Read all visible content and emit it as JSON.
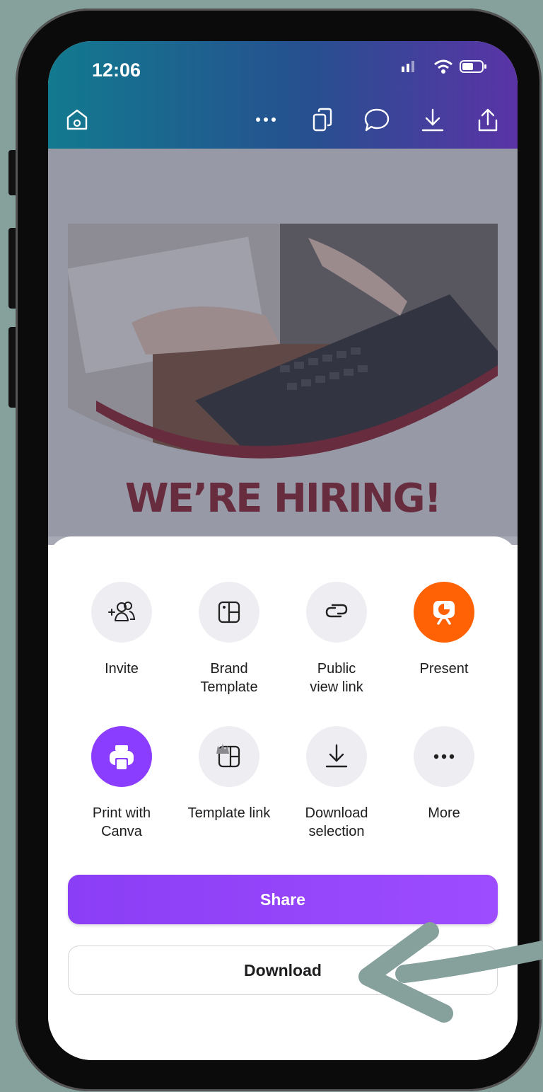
{
  "status_bar": {
    "time": "12:06"
  },
  "toolbar": {
    "icons": [
      "home-icon",
      "more-icon",
      "pages-icon",
      "comment-icon",
      "download-icon",
      "share-icon"
    ]
  },
  "design": {
    "headline": "WE’RE HIRING!"
  },
  "share_sheet": {
    "options_row1": [
      {
        "label": "Invite",
        "icon": "invite-icon"
      },
      {
        "label": "Brand\nTemplate",
        "icon": "brand-template-icon"
      },
      {
        "label": "Public\nview link",
        "icon": "link-icon"
      },
      {
        "label": "Present",
        "icon": "present-icon"
      }
    ],
    "options_row2": [
      {
        "label": "Print with\nCanva",
        "icon": "printer-icon"
      },
      {
        "label": "Template link",
        "icon": "template-link-icon"
      },
      {
        "label": "Download\nselection",
        "icon": "download-icon"
      },
      {
        "label": "More",
        "icon": "more-icon"
      }
    ],
    "share_label": "Share",
    "download_label": "Download"
  },
  "colors": {
    "accent_purple": "#8b3dff",
    "present_orange": "#ff6105",
    "headline_red": "#8b1d26"
  }
}
